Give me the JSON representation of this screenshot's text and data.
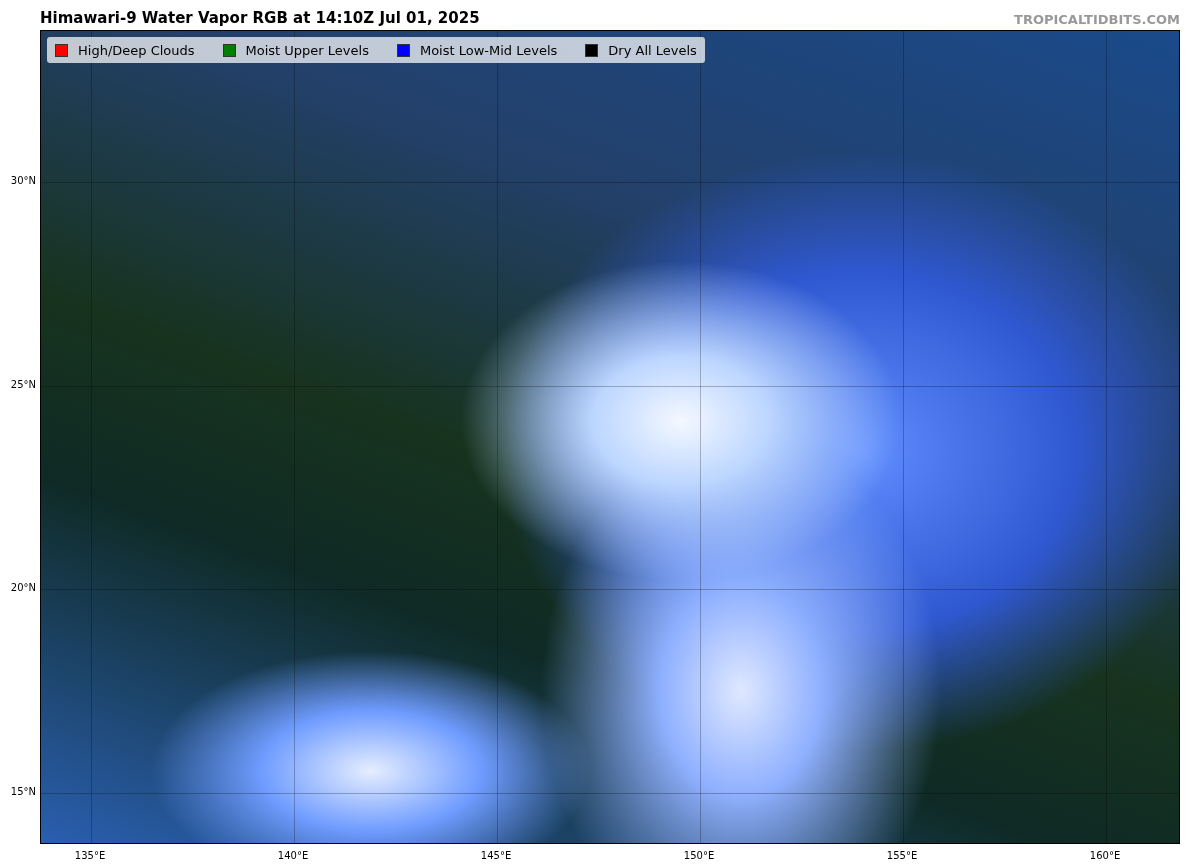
{
  "title": "Himawari-9 Water Vapor RGB at 14:10Z Jul 01, 2025",
  "credit": "TROPICALTIDBITS.COM",
  "legend": [
    {
      "label": "High/Deep Clouds",
      "color": "#ff0000"
    },
    {
      "label": "Moist Upper Levels",
      "color": "#008000"
    },
    {
      "label": "Moist Low-Mid Levels",
      "color": "#0000ff"
    },
    {
      "label": "Dry All Levels",
      "color": "#000000"
    }
  ],
  "latitude_labels": [
    "30°N",
    "25°N",
    "20°N",
    "15°N"
  ],
  "longitude_labels": [
    "135°E",
    "140°E",
    "145°E",
    "150°E",
    "155°E",
    "160°E"
  ]
}
